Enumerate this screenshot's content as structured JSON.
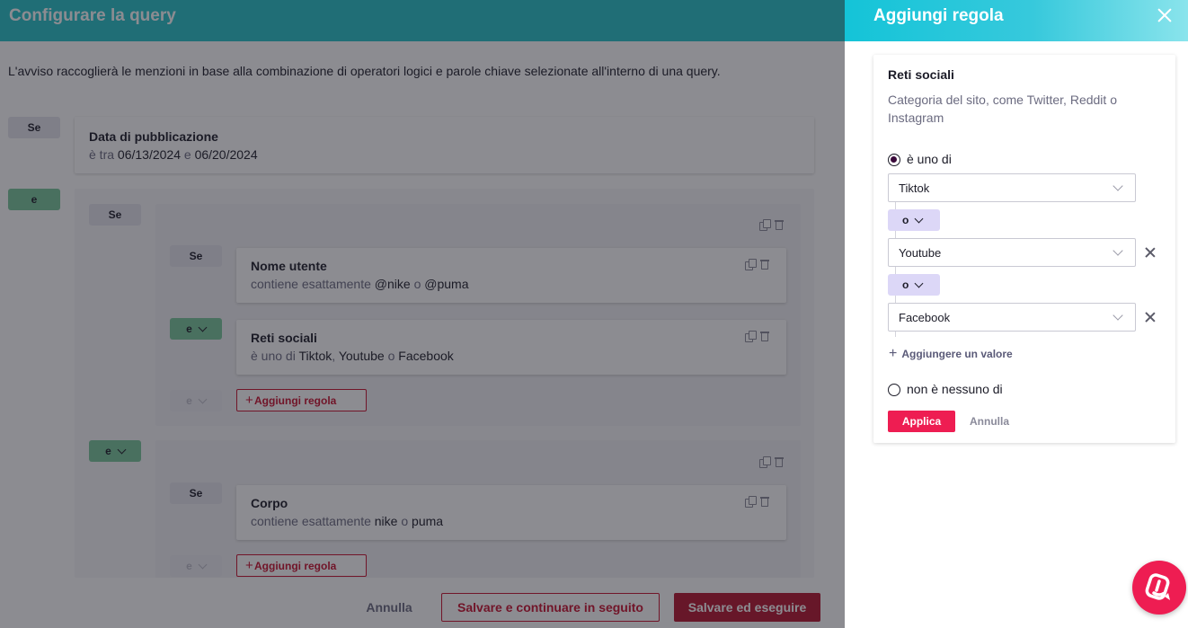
{
  "main": {
    "title": "Configurare la query",
    "description": "L'avviso raccoglierà le menzioni in base alla combinazione di operatori logici e parole chiave selezionate all'interno di una query.",
    "if_label": "Se",
    "and_label": "e",
    "date_rule": {
      "title": "Data di pubblicazione",
      "prefix": "è tra",
      "start": "06/13/2024",
      "joiner": "e",
      "end": "06/20/2024"
    },
    "group1": {
      "username_rule": {
        "title": "Nome utente",
        "prefix": "contiene esattamente",
        "value1": "@nike",
        "joiner": "o",
        "value2": "@puma"
      },
      "social_rule": {
        "title": "Reti sociali",
        "prefix": "è uno di",
        "value1": "Tiktok",
        "sep1": ",",
        "value2": "Youtube",
        "joiner": "o",
        "value3": "Facebook"
      },
      "add_rule_label": "Aggiungi regola"
    },
    "group2": {
      "body_rule": {
        "title": "Corpo",
        "prefix": "contiene esattamente",
        "value1": "nike",
        "joiner": "o",
        "value2": "puma"
      },
      "add_rule_label": "Aggiungi regola"
    },
    "footer": {
      "cancel": "Annulla",
      "save_continue": "Salvare e continuare in seguito",
      "save_run": "Salvare ed eseguire"
    }
  },
  "panel": {
    "title": "Aggiungi regola",
    "card_title": "Reti sociali",
    "card_desc": "Categoria del sito, come Twitter, Reddit o Instagram",
    "option_is_one_of": "è uno di",
    "values": [
      "Tiktok",
      "Youtube",
      "Facebook"
    ],
    "or_label": "o",
    "add_value": "Aggiungere un valore",
    "option_none_of": "non è nessuno di",
    "apply": "Applica",
    "cancel": "Annulla"
  },
  "colors": {
    "header_teal": "#26c2c9",
    "panel_header_start": "#14c4d8",
    "panel_header_end": "#8ae4ec",
    "primary_red": "#ee1d52",
    "save_dark_red": "#b5142e",
    "green_tag": "#79c69a",
    "or_tag": "#dcd7f7"
  }
}
